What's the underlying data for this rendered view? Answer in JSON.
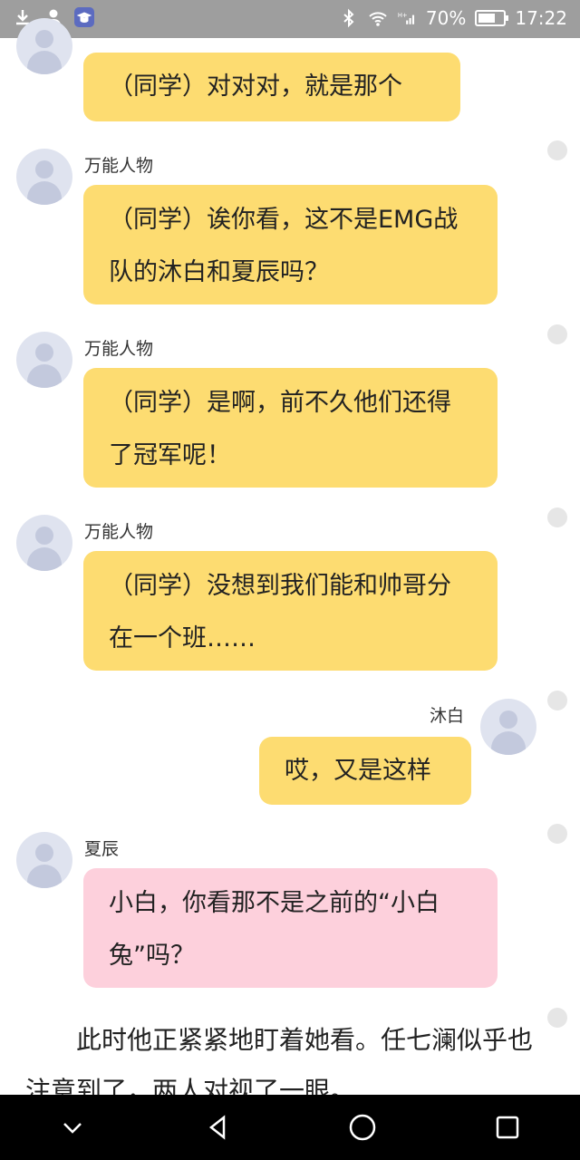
{
  "status_bar": {
    "battery": "70%",
    "time": "17:22",
    "battery_level": 0.7,
    "signal_label": "ᴴ⁺"
  },
  "messages": [
    {
      "speaker": "万能人物",
      "side": "left",
      "text": "（同学）对对对，就是那个",
      "color": "yellow"
    },
    {
      "speaker": "万能人物",
      "side": "left",
      "text": "（同学）诶你看，这不是EMG战队的沐白和夏辰吗？",
      "color": "yellow"
    },
    {
      "speaker": "万能人物",
      "side": "left",
      "text": "（同学）是啊￼，前不久他们还得了冠军呢！",
      "color": "yellow"
    },
    {
      "speaker": "万能人物",
      "side": "left",
      "text": "（同学）没想到我们能和帅哥分在一个班……",
      "color": "yellow"
    },
    {
      "speaker": "沐白",
      "side": "right",
      "text": "哎，又是这样",
      "color": "yellow"
    },
    {
      "speaker": "夏辰",
      "side": "left",
      "text": "小白，你看那不是之前的“小白兔”吗？",
      "color": "pink"
    }
  ],
  "narration": "此时他正紧紧地盯着她看。任七澜似乎也注意到了，两人对视了一眼。",
  "colors": {
    "yellow_bubble": "#fddc71",
    "pink_bubble": "#fdd0dc",
    "status_bar": "#9e9e9e",
    "nav_bar": "#000000"
  },
  "nav": {
    "back": "back-icon",
    "home": "home-icon",
    "recents": "recents-icon",
    "collapse": "chevron-down-icon"
  }
}
